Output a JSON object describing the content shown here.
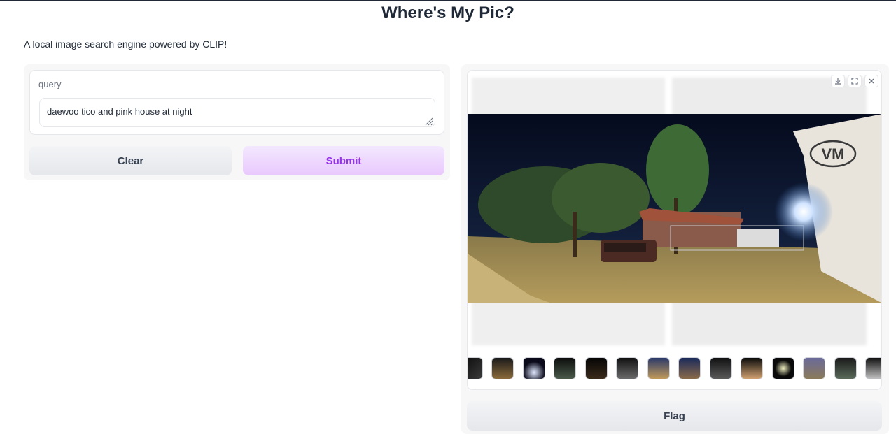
{
  "header": {
    "title": "Where's My Pic?",
    "subtitle": "A local image search engine powered by CLIP!"
  },
  "form": {
    "query_label": "query",
    "query_value": "daewoo tico and pink house at night",
    "clear_label": "Clear",
    "submit_label": "Submit"
  },
  "gallery": {
    "toolbar_icons": [
      "download-icon",
      "fullscreen-icon",
      "close-icon"
    ],
    "thumbnail_count": 14
  },
  "actions": {
    "flag_label": "Flag"
  },
  "colors": {
    "accent": "#9333ea",
    "submit_bg": "#efd9fe",
    "button_bg": "#eceef1"
  }
}
